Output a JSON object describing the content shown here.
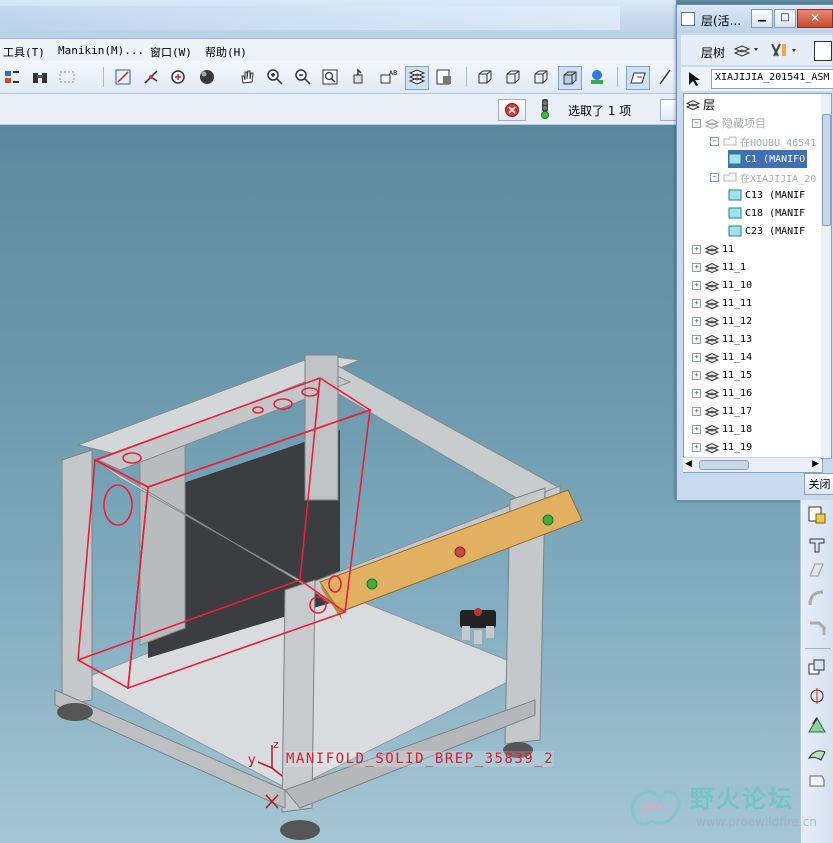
{
  "menu": {
    "tools": "工具(T)",
    "manikin": "Manikin(M)...",
    "window": "窗口(W)",
    "help": "帮助(H)"
  },
  "status": {
    "selected_text": "选取了 1 项"
  },
  "layer_window": {
    "title": "层(活...",
    "tree_tab": "层树",
    "model": "XIAJIJIA_201541_ASM",
    "close_label": "关闭",
    "tree": {
      "root": "层",
      "hidden": "隐藏项目",
      "group1": "在HOUBU_46541",
      "group1_items": [
        "C1 (MANIFO"
      ],
      "group2": "在XIAJIJIA_20",
      "group2_items": [
        "C13 (MANIF",
        "C18 (MANIF",
        "C23 (MANIF"
      ],
      "layers": [
        "11",
        "11_1",
        "11_10",
        "11_11",
        "11_12",
        "11_13",
        "11_14",
        "11_15",
        "11_16",
        "11_17",
        "11_18",
        "11_19"
      ]
    }
  },
  "viewport": {
    "label": "MANIFOLD_SOLID_BREP_35839_2",
    "axis_z": "z",
    "axis_y": "y"
  },
  "watermark": {
    "name": "野火论坛",
    "url": "www.proewildfire.cn"
  },
  "colors": {
    "highlight": "#e8203a",
    "plate": "#e2b061",
    "frame": "#c9cdd0"
  }
}
